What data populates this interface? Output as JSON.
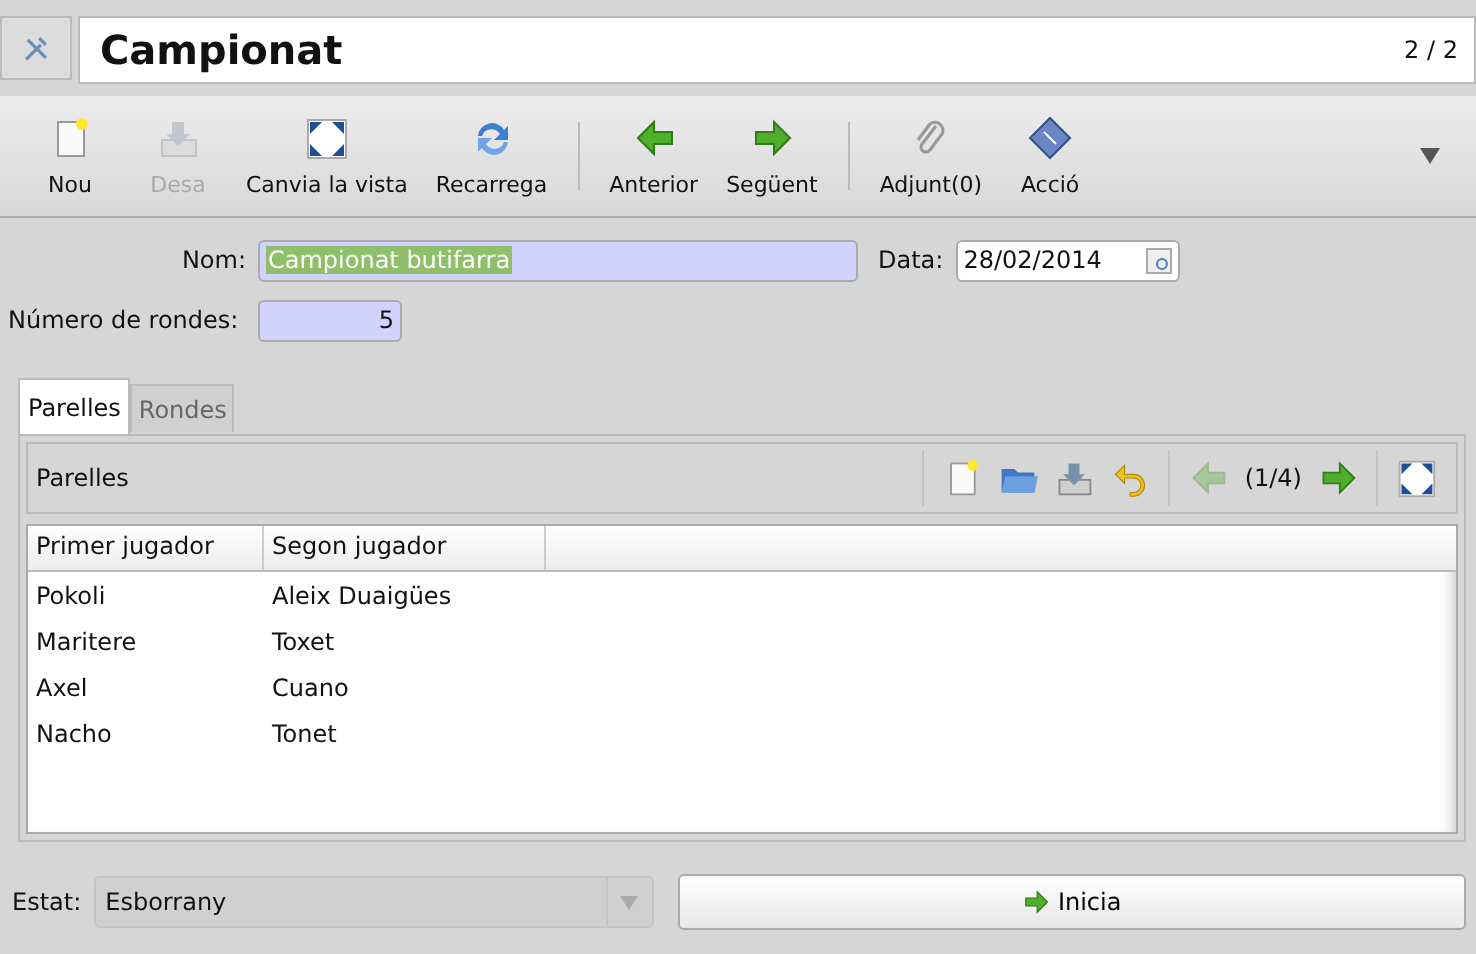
{
  "header": {
    "title": "Campionat",
    "counter": "2 / 2"
  },
  "toolbar": {
    "groups": [
      [
        {
          "kind": "new",
          "label": "Nou",
          "disabled": false
        },
        {
          "kind": "save",
          "label": "Desa",
          "disabled": true
        },
        {
          "kind": "view",
          "label": "Canvia la vista",
          "disabled": false
        },
        {
          "kind": "reload",
          "label": "Recarrega",
          "disabled": false
        }
      ],
      [
        {
          "kind": "prev",
          "label": "Anterior",
          "disabled": false
        },
        {
          "kind": "next",
          "label": "Següent",
          "disabled": false
        }
      ],
      [
        {
          "kind": "attach",
          "label": "Adjunt(0)",
          "disabled": false
        },
        {
          "kind": "action",
          "label": "Acció",
          "disabled": false
        }
      ]
    ]
  },
  "form": {
    "nom": {
      "label": "Nom:",
      "value": "Campionat butifarra",
      "text_selected": true
    },
    "data": {
      "label": "Data:",
      "value": "28/02/2014"
    },
    "rondes": {
      "label": "Número de rondes:",
      "value": "5"
    }
  },
  "tabs": [
    {
      "label": "Parelles",
      "selected": true
    },
    {
      "label": "Rondes",
      "selected": false
    }
  ],
  "panel": {
    "title": "Parelles",
    "tools": [
      [
        {
          "kind": "new",
          "disabled": false
        },
        {
          "kind": "open",
          "disabled": false
        },
        {
          "kind": "save",
          "disabled": false
        },
        {
          "kind": "undo",
          "disabled": false
        }
      ],
      [
        {
          "kind": "prev",
          "disabled": true
        },
        {
          "kind": "text",
          "label": "(1/4)"
        },
        {
          "kind": "next",
          "disabled": false
        }
      ],
      [
        {
          "kind": "view",
          "disabled": false
        }
      ]
    ]
  },
  "table": {
    "columns": [
      "Primer jugador",
      "Segon jugador"
    ],
    "rows": [
      [
        "Pokoli",
        "Aleix Duaigües"
      ],
      [
        "Maritere",
        "Toxet"
      ],
      [
        "Axel",
        "Cuano"
      ],
      [
        "Nacho",
        "Tonet"
      ]
    ]
  },
  "footer": {
    "state_label": "Estat:",
    "state_value": "Esborrany",
    "button": {
      "kind": "next",
      "label": "Inicia"
    }
  }
}
